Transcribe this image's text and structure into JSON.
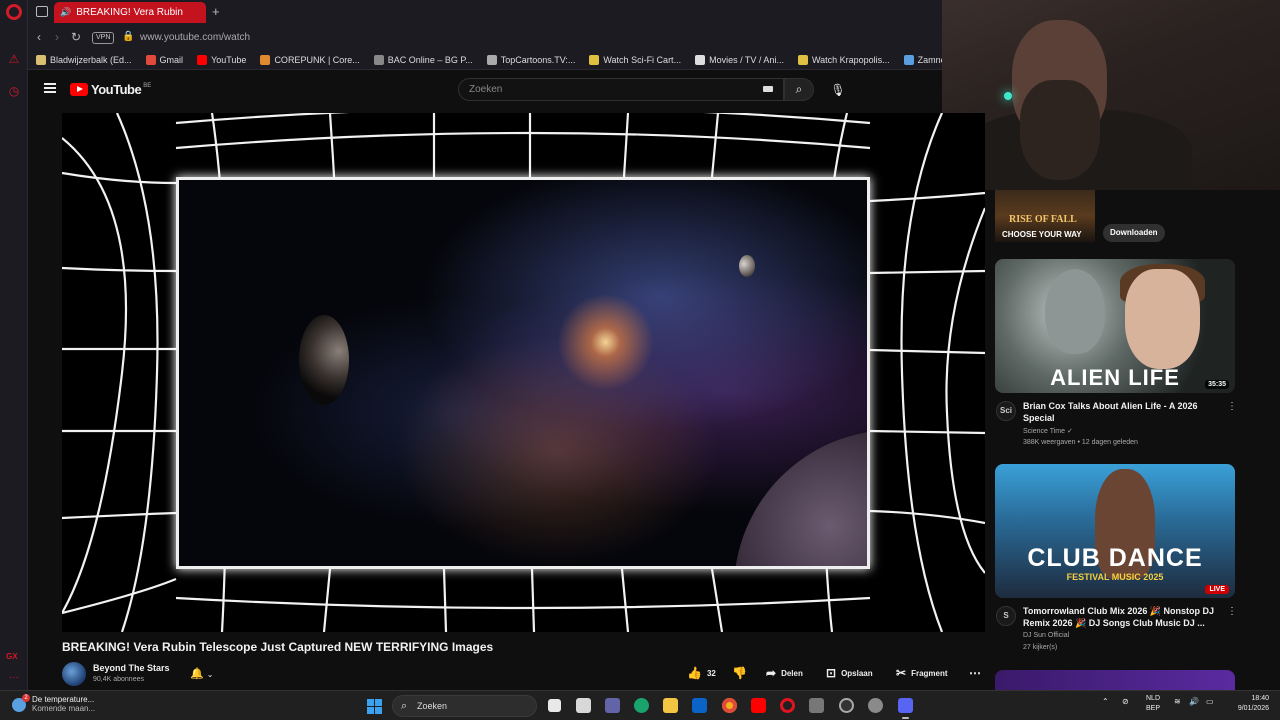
{
  "browser": {
    "tab_title": "BREAKING! Vera Rubin",
    "url": "www.youtube.com/watch",
    "vpn_label": "VPN",
    "bookmarks": [
      {
        "label": "Bladwijzerbalk (Ed...",
        "icon": "folder-icon",
        "color": "#d8c070"
      },
      {
        "label": "Gmail",
        "icon": "gmail-icon",
        "color": "#e04a3a"
      },
      {
        "label": "YouTube",
        "icon": "youtube-icon",
        "color": "#ff0000"
      },
      {
        "label": "COREPUNK | Core...",
        "icon": "corepunk-icon",
        "color": "#e08a30"
      },
      {
        "label": "BAC Online – BG P...",
        "icon": "bac-icon",
        "color": "#888888"
      },
      {
        "label": "TopCartoons.TV:...",
        "icon": "topcartoons-icon",
        "color": "#aaaaaa"
      },
      {
        "label": "Watch Sci-Fi Cart...",
        "icon": "scifi-icon",
        "color": "#e0c040"
      },
      {
        "label": "Movies / TV / Ani...",
        "icon": "play-icon",
        "color": "#dddddd"
      },
      {
        "label": "Watch Krapopolis...",
        "icon": "krapopolis-icon",
        "color": "#e0c040"
      },
      {
        "label": "Zamnesia | Het Be",
        "icon": "zamnesia-icon",
        "color": "#5aa0e0"
      }
    ]
  },
  "youtube": {
    "logo_text": "YouTube",
    "logo_country": "BE",
    "search_placeholder": "Zoeken",
    "video": {
      "title": "BREAKING! Vera Rubin Telescope Just Captured NEW TERRIFYING Images",
      "channel": "Beyond The Stars",
      "subscribers": "90,4K abonnees",
      "likes": "32",
      "actions": {
        "share": "Delen",
        "save": "Opslaan",
        "clip": "Fragment"
      }
    },
    "ad": {
      "title_line": "RISE OF FALL",
      "tagline": "CHOOSE YOUR WAY",
      "button": "Downloaden",
      "button_color": "#303030"
    },
    "recommendations": [
      {
        "thumb_text": "ALIEN LIFE",
        "duration": "35:35",
        "avatar_text": "Sci",
        "title": "Brian Cox Talks About Alien Life - A 2026 Special",
        "channel": "Science Time ✓",
        "stats": "388K weergaven • 12 dagen geleden"
      },
      {
        "thumb_text": "CLUB DANCE",
        "thumb_sub": "FESTIVAL MUSIC 2025",
        "badge": "LIVE",
        "avatar_text": "S",
        "title": "Tomorrowland Club Mix 2026 🎉 Nonstop DJ Remix 2026 🎉 DJ Songs Club Music DJ ...",
        "channel": "DJ Sun Official",
        "stats": "27 kijker(s)"
      }
    ]
  },
  "taskbar": {
    "weather_line1": "De temperature...",
    "weather_line2": "Komende maan...",
    "search": "Zoeken",
    "lang_line1": "NLD",
    "lang_line2": "BEP",
    "time": "18:40",
    "date": "9/01/2026"
  }
}
